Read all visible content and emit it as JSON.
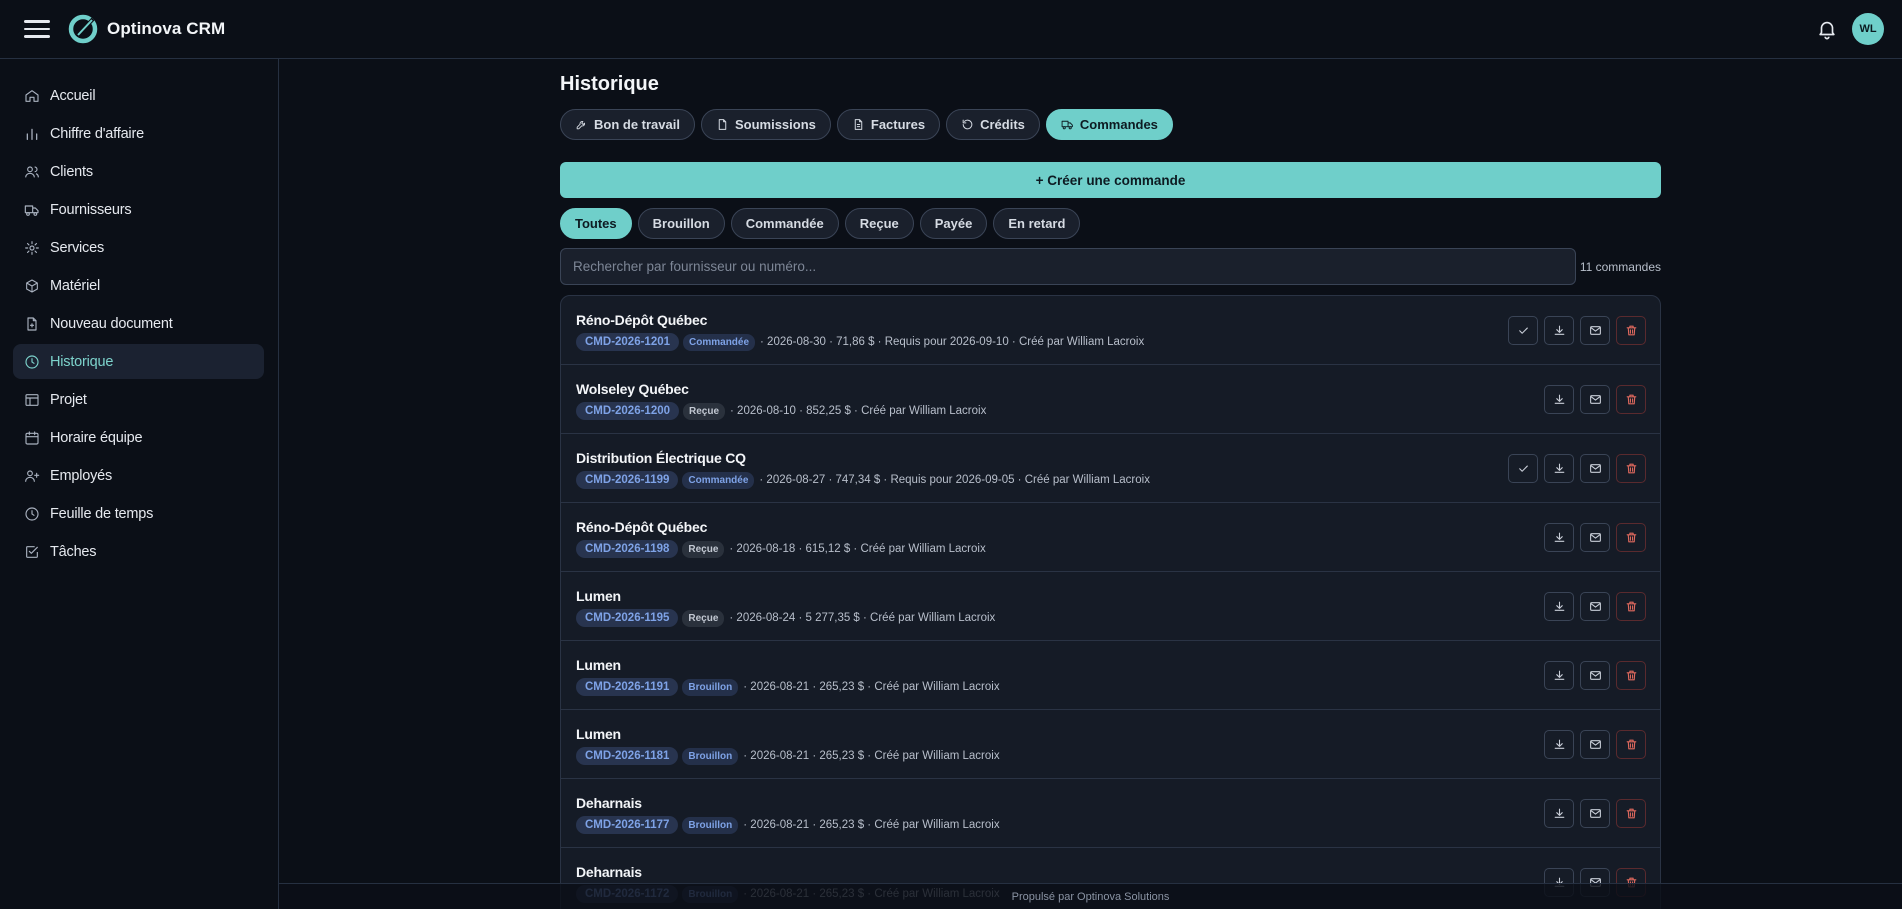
{
  "app": {
    "title": "Optinova CRM",
    "user_initials": "WL"
  },
  "sidebar": {
    "items": [
      {
        "label": "Accueil",
        "icon": "home-icon"
      },
      {
        "label": "Chiffre d'affaire",
        "icon": "bar-chart-icon"
      },
      {
        "label": "Clients",
        "icon": "users-icon"
      },
      {
        "label": "Fournisseurs",
        "icon": "truck-icon"
      },
      {
        "label": "Services",
        "icon": "gear-icon"
      },
      {
        "label": "Matériel",
        "icon": "box-icon"
      },
      {
        "label": "Nouveau document",
        "icon": "file-plus-icon"
      },
      {
        "label": "Historique",
        "icon": "clock-icon",
        "active": true
      },
      {
        "label": "Projet",
        "icon": "layout-icon"
      },
      {
        "label": "Horaire équipe",
        "icon": "calendar-icon"
      },
      {
        "label": "Employés",
        "icon": "user-plus-icon"
      },
      {
        "label": "Feuille de temps",
        "icon": "clock-icon"
      },
      {
        "label": "Tâches",
        "icon": "check-square-icon"
      }
    ]
  },
  "main": {
    "title": "Historique",
    "tabs": [
      {
        "label": "Bon de travail",
        "icon": "wrench-icon"
      },
      {
        "label": "Soumissions",
        "icon": "file-icon"
      },
      {
        "label": "Factures",
        "icon": "file-text-icon"
      },
      {
        "label": "Crédits",
        "icon": "undo-icon"
      },
      {
        "label": "Commandes",
        "icon": "truck-icon",
        "active": true
      }
    ],
    "create_label": "+ Créer une commande",
    "filters": [
      "Toutes",
      "Brouillon",
      "Commandée",
      "Reçue",
      "Payée",
      "En retard"
    ],
    "active_filter": "Toutes",
    "search_placeholder": "Rechercher par fournisseur ou numéro...",
    "count": "11 commandes",
    "orders": [
      {
        "supplier": "Réno-Dépôt Québec",
        "code": "CMD-2026-1201",
        "status": "Commandée",
        "status_key": "commandee",
        "meta": "· 2026-08-30 · 71,86 $ · Requis pour 2026-09-10 · Créé par William Lacroix",
        "can_confirm": true
      },
      {
        "supplier": "Wolseley Québec",
        "code": "CMD-2026-1200",
        "status": "Reçue",
        "status_key": "recue",
        "meta": "· 2026-08-10 · 852,25 $ · Créé par William Lacroix",
        "can_confirm": false
      },
      {
        "supplier": "Distribution Électrique CQ",
        "code": "CMD-2026-1199",
        "status": "Commandée",
        "status_key": "commandee",
        "meta": "· 2026-08-27 · 747,34 $ · Requis pour 2026-09-05 · Créé par William Lacroix",
        "can_confirm": true
      },
      {
        "supplier": "Réno-Dépôt Québec",
        "code": "CMD-2026-1198",
        "status": "Reçue",
        "status_key": "recue",
        "meta": "· 2026-08-18 · 615,12 $ · Créé par William Lacroix",
        "can_confirm": false
      },
      {
        "supplier": "Lumen",
        "code": "CMD-2026-1195",
        "status": "Reçue",
        "status_key": "recue",
        "meta": "· 2026-08-24 · 5 277,35 $ · Créé par William Lacroix",
        "can_confirm": false
      },
      {
        "supplier": "Lumen",
        "code": "CMD-2026-1191",
        "status": "Brouillon",
        "status_key": "brouillon",
        "meta": "· 2026-08-21 · 265,23 $ · Créé par William Lacroix",
        "can_confirm": false
      },
      {
        "supplier": "Lumen",
        "code": "CMD-2026-1181",
        "status": "Brouillon",
        "status_key": "brouillon",
        "meta": "· 2026-08-21 · 265,23 $ · Créé par William Lacroix",
        "can_confirm": false
      },
      {
        "supplier": "Deharnais",
        "code": "CMD-2026-1177",
        "status": "Brouillon",
        "status_key": "brouillon",
        "meta": "· 2026-08-21 · 265,23 $ · Créé par William Lacroix",
        "can_confirm": false
      },
      {
        "supplier": "Deharnais",
        "code": "CMD-2026-1172",
        "status": "Brouillon",
        "status_key": "brouillon",
        "meta": "· 2026-08-21 · 265,23 $ · Créé par William Lacroix",
        "can_confirm": false
      }
    ]
  },
  "footer": {
    "text": "Propulsé par Optinova Solutions"
  },
  "colors": {
    "accent": "#6fcfca",
    "background": "#0b0f17",
    "danger": "#e26a5f",
    "code_blue": "#7ea2e6"
  }
}
